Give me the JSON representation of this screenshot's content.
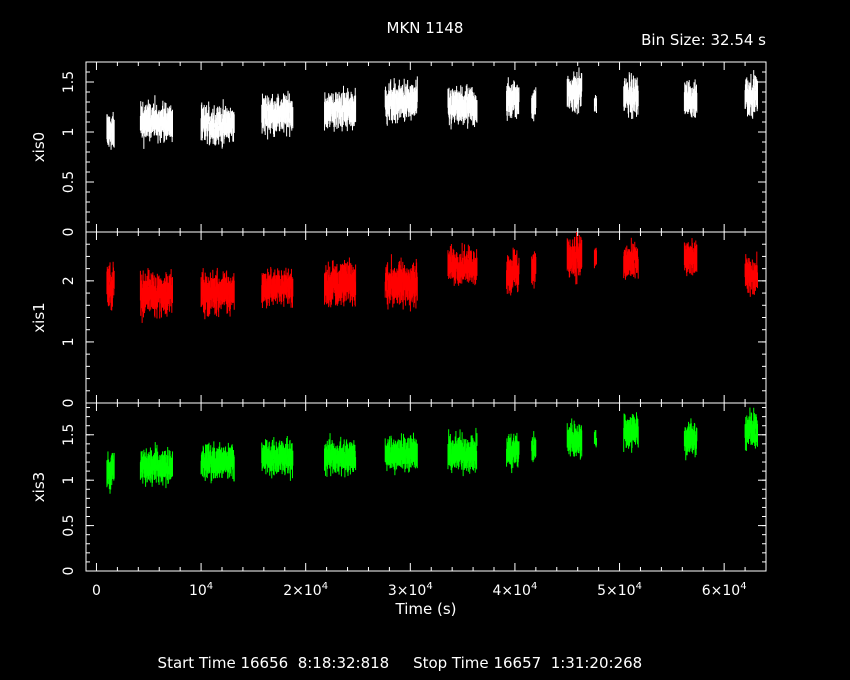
{
  "header": {
    "title": "MKN 1148",
    "bin_size": "Bin Size: 32.54 s"
  },
  "footer": {
    "start_label": "Start Time",
    "start_value": "16656  8:18:32:818",
    "stop_label": "Stop Time",
    "stop_value": "16657  1:31:20:268"
  },
  "chart_data": {
    "type": "scatter",
    "title": "MKN 1148",
    "xlabel": "Time (s)",
    "xlim": [
      -1000,
      64000
    ],
    "xticks": [
      {
        "value": 0,
        "label": "0"
      },
      {
        "value": 10000,
        "label": "10^4"
      },
      {
        "value": 20000,
        "label": "2×10^4"
      },
      {
        "value": 30000,
        "label": "3×10^4"
      },
      {
        "value": 40000,
        "label": "4×10^4"
      },
      {
        "value": 50000,
        "label": "5×10^4"
      },
      {
        "value": 60000,
        "label": "6×10^4"
      }
    ],
    "series": [
      {
        "name": "xis0",
        "ylabel": "xis0",
        "color": "#ffffff",
        "ylim": [
          0,
          1.7
        ],
        "yticks": [
          0,
          0.5,
          1,
          1.5
        ],
        "segments": [
          {
            "x": [
              1000,
              1700
            ],
            "level": 1.0,
            "scatter": 0.1
          },
          {
            "x": [
              4200,
              7300
            ],
            "level": 1.1,
            "scatter": 0.1
          },
          {
            "x": [
              10000,
              13200
            ],
            "level": 1.07,
            "scatter": 0.1
          },
          {
            "x": [
              15800,
              18800
            ],
            "level": 1.18,
            "scatter": 0.1
          },
          {
            "x": [
              21800,
              24800
            ],
            "level": 1.22,
            "scatter": 0.1
          },
          {
            "x": [
              27600,
              30700
            ],
            "level": 1.3,
            "scatter": 0.1
          },
          {
            "x": [
              33600,
              36400
            ],
            "level": 1.25,
            "scatter": 0.1
          },
          {
            "x": [
              39200,
              40400
            ],
            "level": 1.32,
            "scatter": 0.1
          },
          {
            "x": [
              41600,
              42000
            ],
            "level": 1.3,
            "scatter": 0.08
          },
          {
            "x": [
              45000,
              46400
            ],
            "level": 1.4,
            "scatter": 0.1
          },
          {
            "x": [
              47600,
              47800
            ],
            "level": 1.3,
            "scatter": 0.05
          },
          {
            "x": [
              50400,
              51800
            ],
            "level": 1.35,
            "scatter": 0.1
          },
          {
            "x": [
              56200,
              57400
            ],
            "level": 1.32,
            "scatter": 0.1
          },
          {
            "x": [
              62000,
              63200
            ],
            "level": 1.38,
            "scatter": 0.1
          }
        ]
      },
      {
        "name": "xis1",
        "ylabel": "xis1",
        "color": "#ff0000",
        "ylim": [
          0,
          2.8
        ],
        "yticks": [
          0,
          1,
          2
        ],
        "segments": [
          {
            "x": [
              1000,
              1700
            ],
            "level": 1.9,
            "scatter": 0.18
          },
          {
            "x": [
              4200,
              7300
            ],
            "level": 1.8,
            "scatter": 0.18
          },
          {
            "x": [
              10000,
              13200
            ],
            "level": 1.8,
            "scatter": 0.18
          },
          {
            "x": [
              15800,
              18800
            ],
            "level": 1.9,
            "scatter": 0.15
          },
          {
            "x": [
              21800,
              24800
            ],
            "level": 1.95,
            "scatter": 0.18
          },
          {
            "x": [
              27600,
              30700
            ],
            "level": 1.95,
            "scatter": 0.18
          },
          {
            "x": [
              33600,
              36400
            ],
            "level": 2.25,
            "scatter": 0.15
          },
          {
            "x": [
              39200,
              40400
            ],
            "level": 2.15,
            "scatter": 0.18
          },
          {
            "x": [
              41600,
              42000
            ],
            "level": 2.2,
            "scatter": 0.15
          },
          {
            "x": [
              45000,
              46400
            ],
            "level": 2.4,
            "scatter": 0.18
          },
          {
            "x": [
              47600,
              47800
            ],
            "level": 2.4,
            "scatter": 0.1
          },
          {
            "x": [
              50400,
              51800
            ],
            "level": 2.3,
            "scatter": 0.15
          },
          {
            "x": [
              56200,
              57400
            ],
            "level": 2.35,
            "scatter": 0.15
          },
          {
            "x": [
              62000,
              63200
            ],
            "level": 2.1,
            "scatter": 0.15
          }
        ]
      },
      {
        "name": "xis3",
        "ylabel": "xis3",
        "color": "#00ff00",
        "ylim": [
          0,
          1.85
        ],
        "yticks": [
          0,
          0.5,
          1,
          1.5
        ],
        "segments": [
          {
            "x": [
              1000,
              1700
            ],
            "level": 1.1,
            "scatter": 0.1
          },
          {
            "x": [
              4200,
              7300
            ],
            "level": 1.15,
            "scatter": 0.1
          },
          {
            "x": [
              10000,
              13200
            ],
            "level": 1.2,
            "scatter": 0.1
          },
          {
            "x": [
              15800,
              18800
            ],
            "level": 1.25,
            "scatter": 0.1
          },
          {
            "x": [
              21800,
              24800
            ],
            "level": 1.25,
            "scatter": 0.1
          },
          {
            "x": [
              27600,
              30700
            ],
            "level": 1.3,
            "scatter": 0.1
          },
          {
            "x": [
              33600,
              36400
            ],
            "level": 1.3,
            "scatter": 0.1
          },
          {
            "x": [
              39200,
              40400
            ],
            "level": 1.32,
            "scatter": 0.1
          },
          {
            "x": [
              41600,
              42000
            ],
            "level": 1.35,
            "scatter": 0.08
          },
          {
            "x": [
              45000,
              46400
            ],
            "level": 1.45,
            "scatter": 0.1
          },
          {
            "x": [
              47600,
              47800
            ],
            "level": 1.45,
            "scatter": 0.05
          },
          {
            "x": [
              50400,
              51800
            ],
            "level": 1.55,
            "scatter": 0.1
          },
          {
            "x": [
              56200,
              57400
            ],
            "level": 1.45,
            "scatter": 0.1
          },
          {
            "x": [
              62000,
              63200
            ],
            "level": 1.55,
            "scatter": 0.1
          }
        ]
      }
    ],
    "grid": false,
    "legend": "none"
  }
}
